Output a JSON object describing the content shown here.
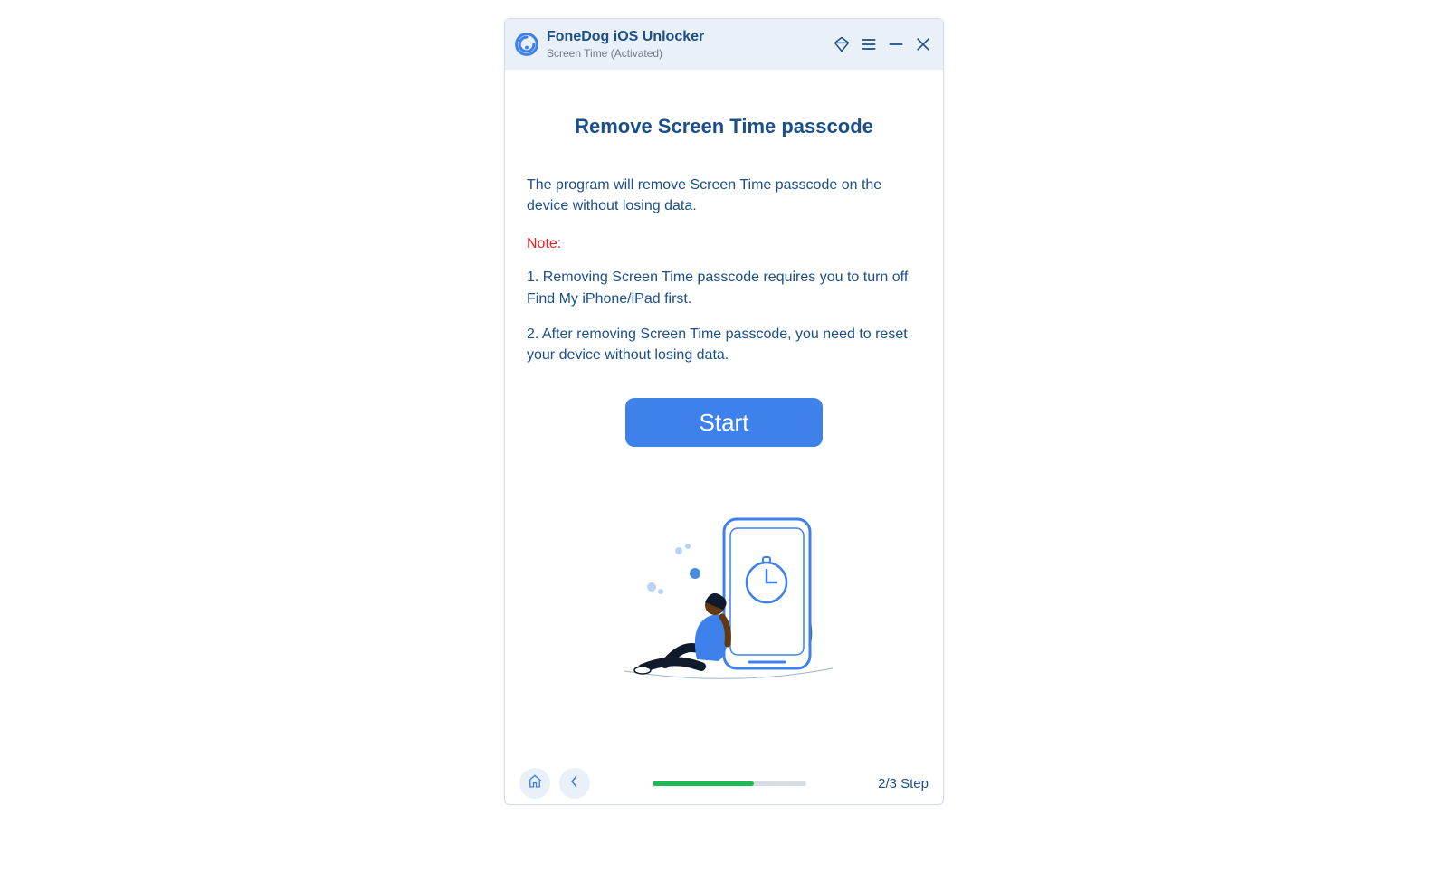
{
  "header": {
    "app_title": "FoneDog iOS Unlocker",
    "subtitle": "Screen Time  (Activated)"
  },
  "main": {
    "heading": "Remove Screen Time passcode",
    "description": "The program will remove Screen Time passcode on the device without losing data.",
    "note_label": "Note:",
    "notes": [
      "1. Removing Screen Time passcode requires you to turn off Find My iPhone/iPad first.",
      "2. After removing Screen Time passcode, you need to reset your device without losing data."
    ],
    "start_label": "Start"
  },
  "footer": {
    "step_label": "2/3 Step",
    "progress_percent": 66
  },
  "colors": {
    "brand": "#1b4f8a",
    "accent": "#3e81ea",
    "note": "#e02424",
    "progress": "#1db954",
    "titlebar_bg": "#eaf0f8"
  }
}
